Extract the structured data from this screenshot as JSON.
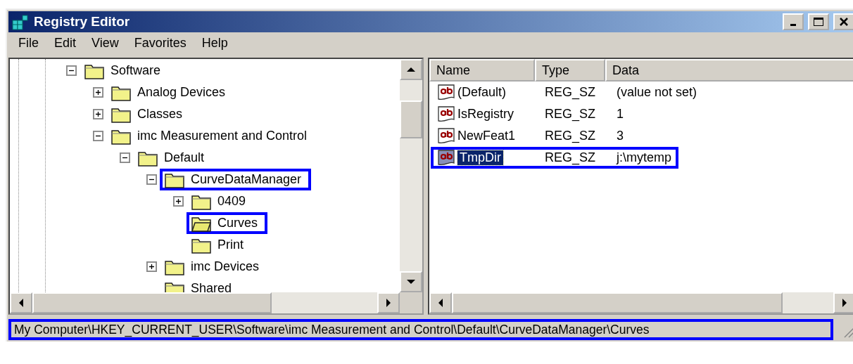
{
  "window": {
    "title": "Registry Editor"
  },
  "menu": [
    "File",
    "Edit",
    "View",
    "Favorites",
    "Help"
  ],
  "tree": [
    {
      "label": "Software",
      "expanded": true,
      "selected": false,
      "highlighted": false,
      "children": [
        {
          "label": "Analog Devices",
          "expanded": false,
          "selected": false,
          "highlighted": false
        },
        {
          "label": "Classes",
          "expanded": false,
          "selected": false,
          "highlighted": false
        },
        {
          "label": "imc Measurement and Control",
          "expanded": true,
          "selected": false,
          "highlighted": false,
          "children": [
            {
              "label": "Default",
              "expanded": true,
              "selected": false,
              "highlighted": false,
              "children": [
                {
                  "label": "CurveDataManager",
                  "expanded": true,
                  "selected": false,
                  "highlighted": true,
                  "children": [
                    {
                      "label": "0409",
                      "expanded": false,
                      "selected": false,
                      "highlighted": false
                    },
                    {
                      "label": "Curves",
                      "selected": true,
                      "highlighted": true
                    },
                    {
                      "label": "Print",
                      "selected": false,
                      "highlighted": false
                    }
                  ]
                },
                {
                  "label": "imc Devices",
                  "expanded": false,
                  "selected": false,
                  "highlighted": false
                },
                {
                  "label": "Shared",
                  "selected": false,
                  "highlighted": false
                }
              ]
            }
          ]
        }
      ]
    }
  ],
  "values": {
    "columns": [
      "Name",
      "Type",
      "Data"
    ],
    "rows": [
      {
        "name": "(Default)",
        "type": "REG_SZ",
        "data": "(value not set)",
        "selected": false,
        "highlighted": false
      },
      {
        "name": "IsRegistry",
        "type": "REG_SZ",
        "data": "1",
        "selected": false,
        "highlighted": false
      },
      {
        "name": "NewFeat1",
        "type": "REG_SZ",
        "data": "3",
        "selected": false,
        "highlighted": false
      },
      {
        "name": "TmpDir",
        "type": "REG_SZ",
        "data": "j:\\mytemp",
        "selected": true,
        "highlighted": true
      }
    ]
  },
  "status_bar": {
    "text": "My Computer\\HKEY_CURRENT_USER\\Software\\imc Measurement and Control\\Default\\CurveDataManager\\Curves",
    "highlighted": true
  }
}
